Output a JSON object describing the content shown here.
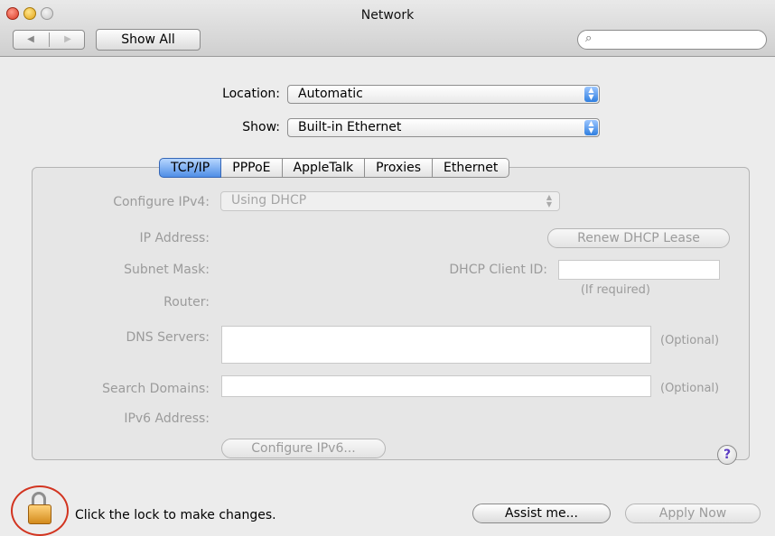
{
  "window": {
    "title": "Network"
  },
  "toolbar": {
    "back_glyph": "◀",
    "forward_glyph": "▶",
    "show_all_label": "Show All",
    "search_icon": "search-icon",
    "search_glyph": "⌕",
    "search_value": ""
  },
  "location": {
    "label": "Location:",
    "value": "Automatic"
  },
  "show": {
    "label": "Show:",
    "value": "Built-in Ethernet"
  },
  "tabs": [
    "TCP/IP",
    "PPPoE",
    "AppleTalk",
    "Proxies",
    "Ethernet"
  ],
  "tcpip": {
    "configure_label": "Configure IPv4:",
    "configure_value": "Using DHCP",
    "ip_label": "IP Address:",
    "renew_button": "Renew DHCP Lease",
    "subnet_label": "Subnet Mask:",
    "dhcp_client_label": "DHCP Client ID:",
    "dhcp_client_value": "",
    "if_required": "(If required)",
    "router_label": "Router:",
    "dns_label": "DNS Servers:",
    "dns_value": "",
    "dns_optional": "(Optional)",
    "search_domains_label": "Search Domains:",
    "search_domains_value": "",
    "search_optional": "(Optional)",
    "ipv6_label": "IPv6 Address:",
    "configure_ipv6_button": "Configure IPv6...",
    "help_glyph": "?"
  },
  "footer": {
    "lock_text": "Click the lock to make changes.",
    "assist_button": "Assist me...",
    "apply_button": "Apply Now"
  }
}
